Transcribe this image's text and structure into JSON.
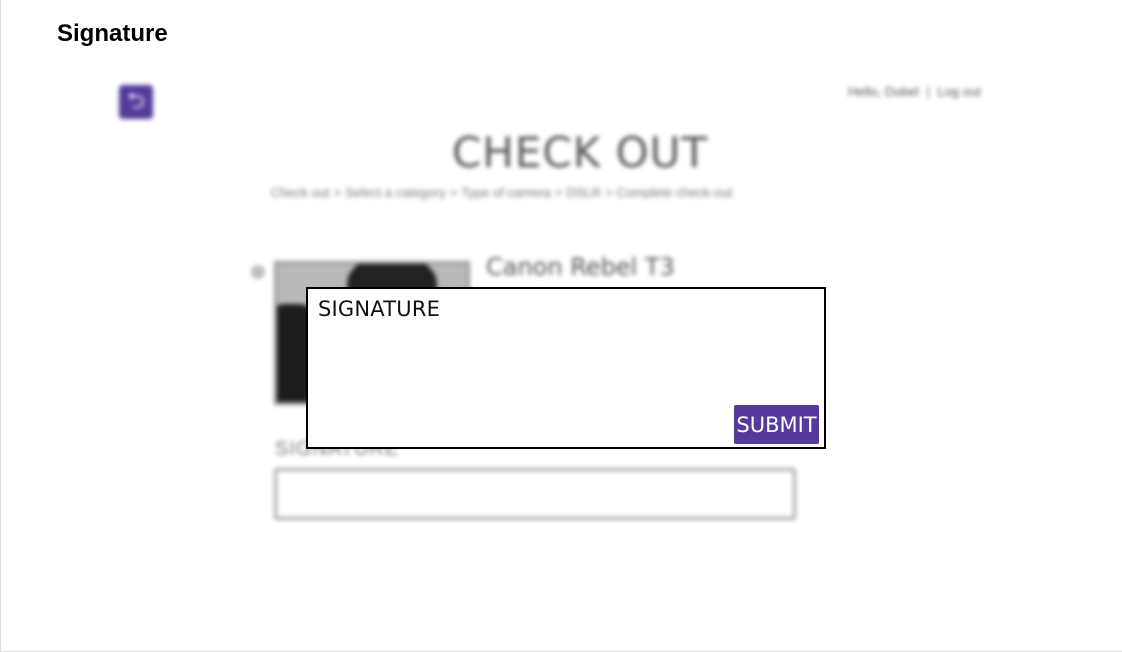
{
  "screen_title": "Signature",
  "header": {
    "back_icon": "return-arrow-icon",
    "greeting": "Hello, Dubel",
    "divider": "|",
    "logout": "Log out"
  },
  "page_heading": "CHECK OUT",
  "breadcrumb": [
    "Check out",
    "Select a category",
    "Type of camera",
    "DSLR",
    "Complete check-out"
  ],
  "product": {
    "name": "Canon Rebel T3"
  },
  "signature_section": {
    "label": "SIGNATURE"
  },
  "modal": {
    "title": "SIGNATURE",
    "submit_label": "SUBMIT"
  },
  "colors": {
    "accent": "#553a9c"
  }
}
